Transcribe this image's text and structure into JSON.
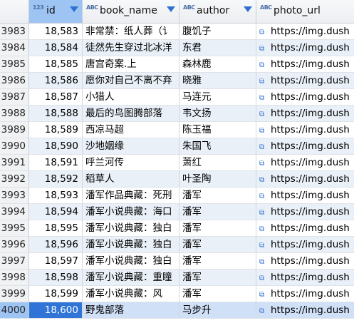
{
  "columns": [
    {
      "name": "id",
      "type_icon": "123"
    },
    {
      "name": "book_name",
      "type_icon": "ABC"
    },
    {
      "name": "author",
      "type_icon": "ABC"
    },
    {
      "name": "photo_url",
      "type_icon": "ABC"
    }
  ],
  "rows": [
    {
      "rn": "3983",
      "id": "18,583",
      "book_name": "非常禁：纸人葬（讠",
      "author": "腹饥子",
      "photo_url": "https://img.dush"
    },
    {
      "rn": "3984",
      "id": "18,584",
      "book_name": "徒然先生穿过北冰洋",
      "author": "东君",
      "photo_url": "https://img.dush"
    },
    {
      "rn": "3985",
      "id": "18,585",
      "book_name": "唐宫奇案.上",
      "author": "森林鹿",
      "photo_url": "https://img.dush"
    },
    {
      "rn": "3986",
      "id": "18,586",
      "book_name": "愿你对自己不离不弃",
      "author": "晓雅",
      "photo_url": "https://img.dush"
    },
    {
      "rn": "3987",
      "id": "18,587",
      "book_name": "小猎人",
      "author": "马连元",
      "photo_url": "https://img.dush"
    },
    {
      "rn": "3988",
      "id": "18,588",
      "book_name": "最后的鸟图腾部落",
      "author": "韦文扬",
      "photo_url": "https://img.dush"
    },
    {
      "rn": "3989",
      "id": "18,589",
      "book_name": "西凉马超",
      "author": "陈玉福",
      "photo_url": "https://img.dush"
    },
    {
      "rn": "3990",
      "id": "18,590",
      "book_name": "沙地姻缘",
      "author": "朱国飞",
      "photo_url": "https://img.dush"
    },
    {
      "rn": "3991",
      "id": "18,591",
      "book_name": "呼兰河传",
      "author": "萧红",
      "photo_url": "https://img.dush"
    },
    {
      "rn": "3992",
      "id": "18,592",
      "book_name": "稻草人",
      "author": "叶圣陶",
      "photo_url": "https://img.dush"
    },
    {
      "rn": "3993",
      "id": "18,593",
      "book_name": "潘军作品典藏：死刑",
      "author": "潘军",
      "photo_url": "https://img.dush"
    },
    {
      "rn": "3994",
      "id": "18,594",
      "book_name": "潘军小说典藏：海口",
      "author": "潘军",
      "photo_url": "https://img.dush"
    },
    {
      "rn": "3995",
      "id": "18,595",
      "book_name": "潘军小说典藏：独白",
      "author": "潘军",
      "photo_url": "https://img.dush"
    },
    {
      "rn": "3996",
      "id": "18,596",
      "book_name": "潘军小说典藏：独白",
      "author": "潘军",
      "photo_url": "https://img.dush"
    },
    {
      "rn": "3997",
      "id": "18,597",
      "book_name": "潘军小说典藏：独白",
      "author": "潘军",
      "photo_url": "https://img.dush"
    },
    {
      "rn": "3998",
      "id": "18,598",
      "book_name": "潘军小说典藏：重瞳",
      "author": "潘军",
      "photo_url": "https://img.dush"
    },
    {
      "rn": "3999",
      "id": "18,599",
      "book_name": "潘军小说典藏：风",
      "author": "潘军",
      "photo_url": "https://img.dush"
    },
    {
      "rn": "4000",
      "id": "18,600",
      "book_name": "野鬼部落",
      "author": "马步升",
      "photo_url": "https://img.dush"
    }
  ],
  "selected_row_index": 17,
  "colors": {
    "accent": "#2f74d6",
    "header_selected": "#9ec4f3",
    "alt_row": "#e9f0f8"
  },
  "icons": {
    "type_number": "number-type-icon",
    "type_text": "text-type-icon",
    "link": "external-link-icon",
    "sort": "sort-dropdown-icon"
  }
}
